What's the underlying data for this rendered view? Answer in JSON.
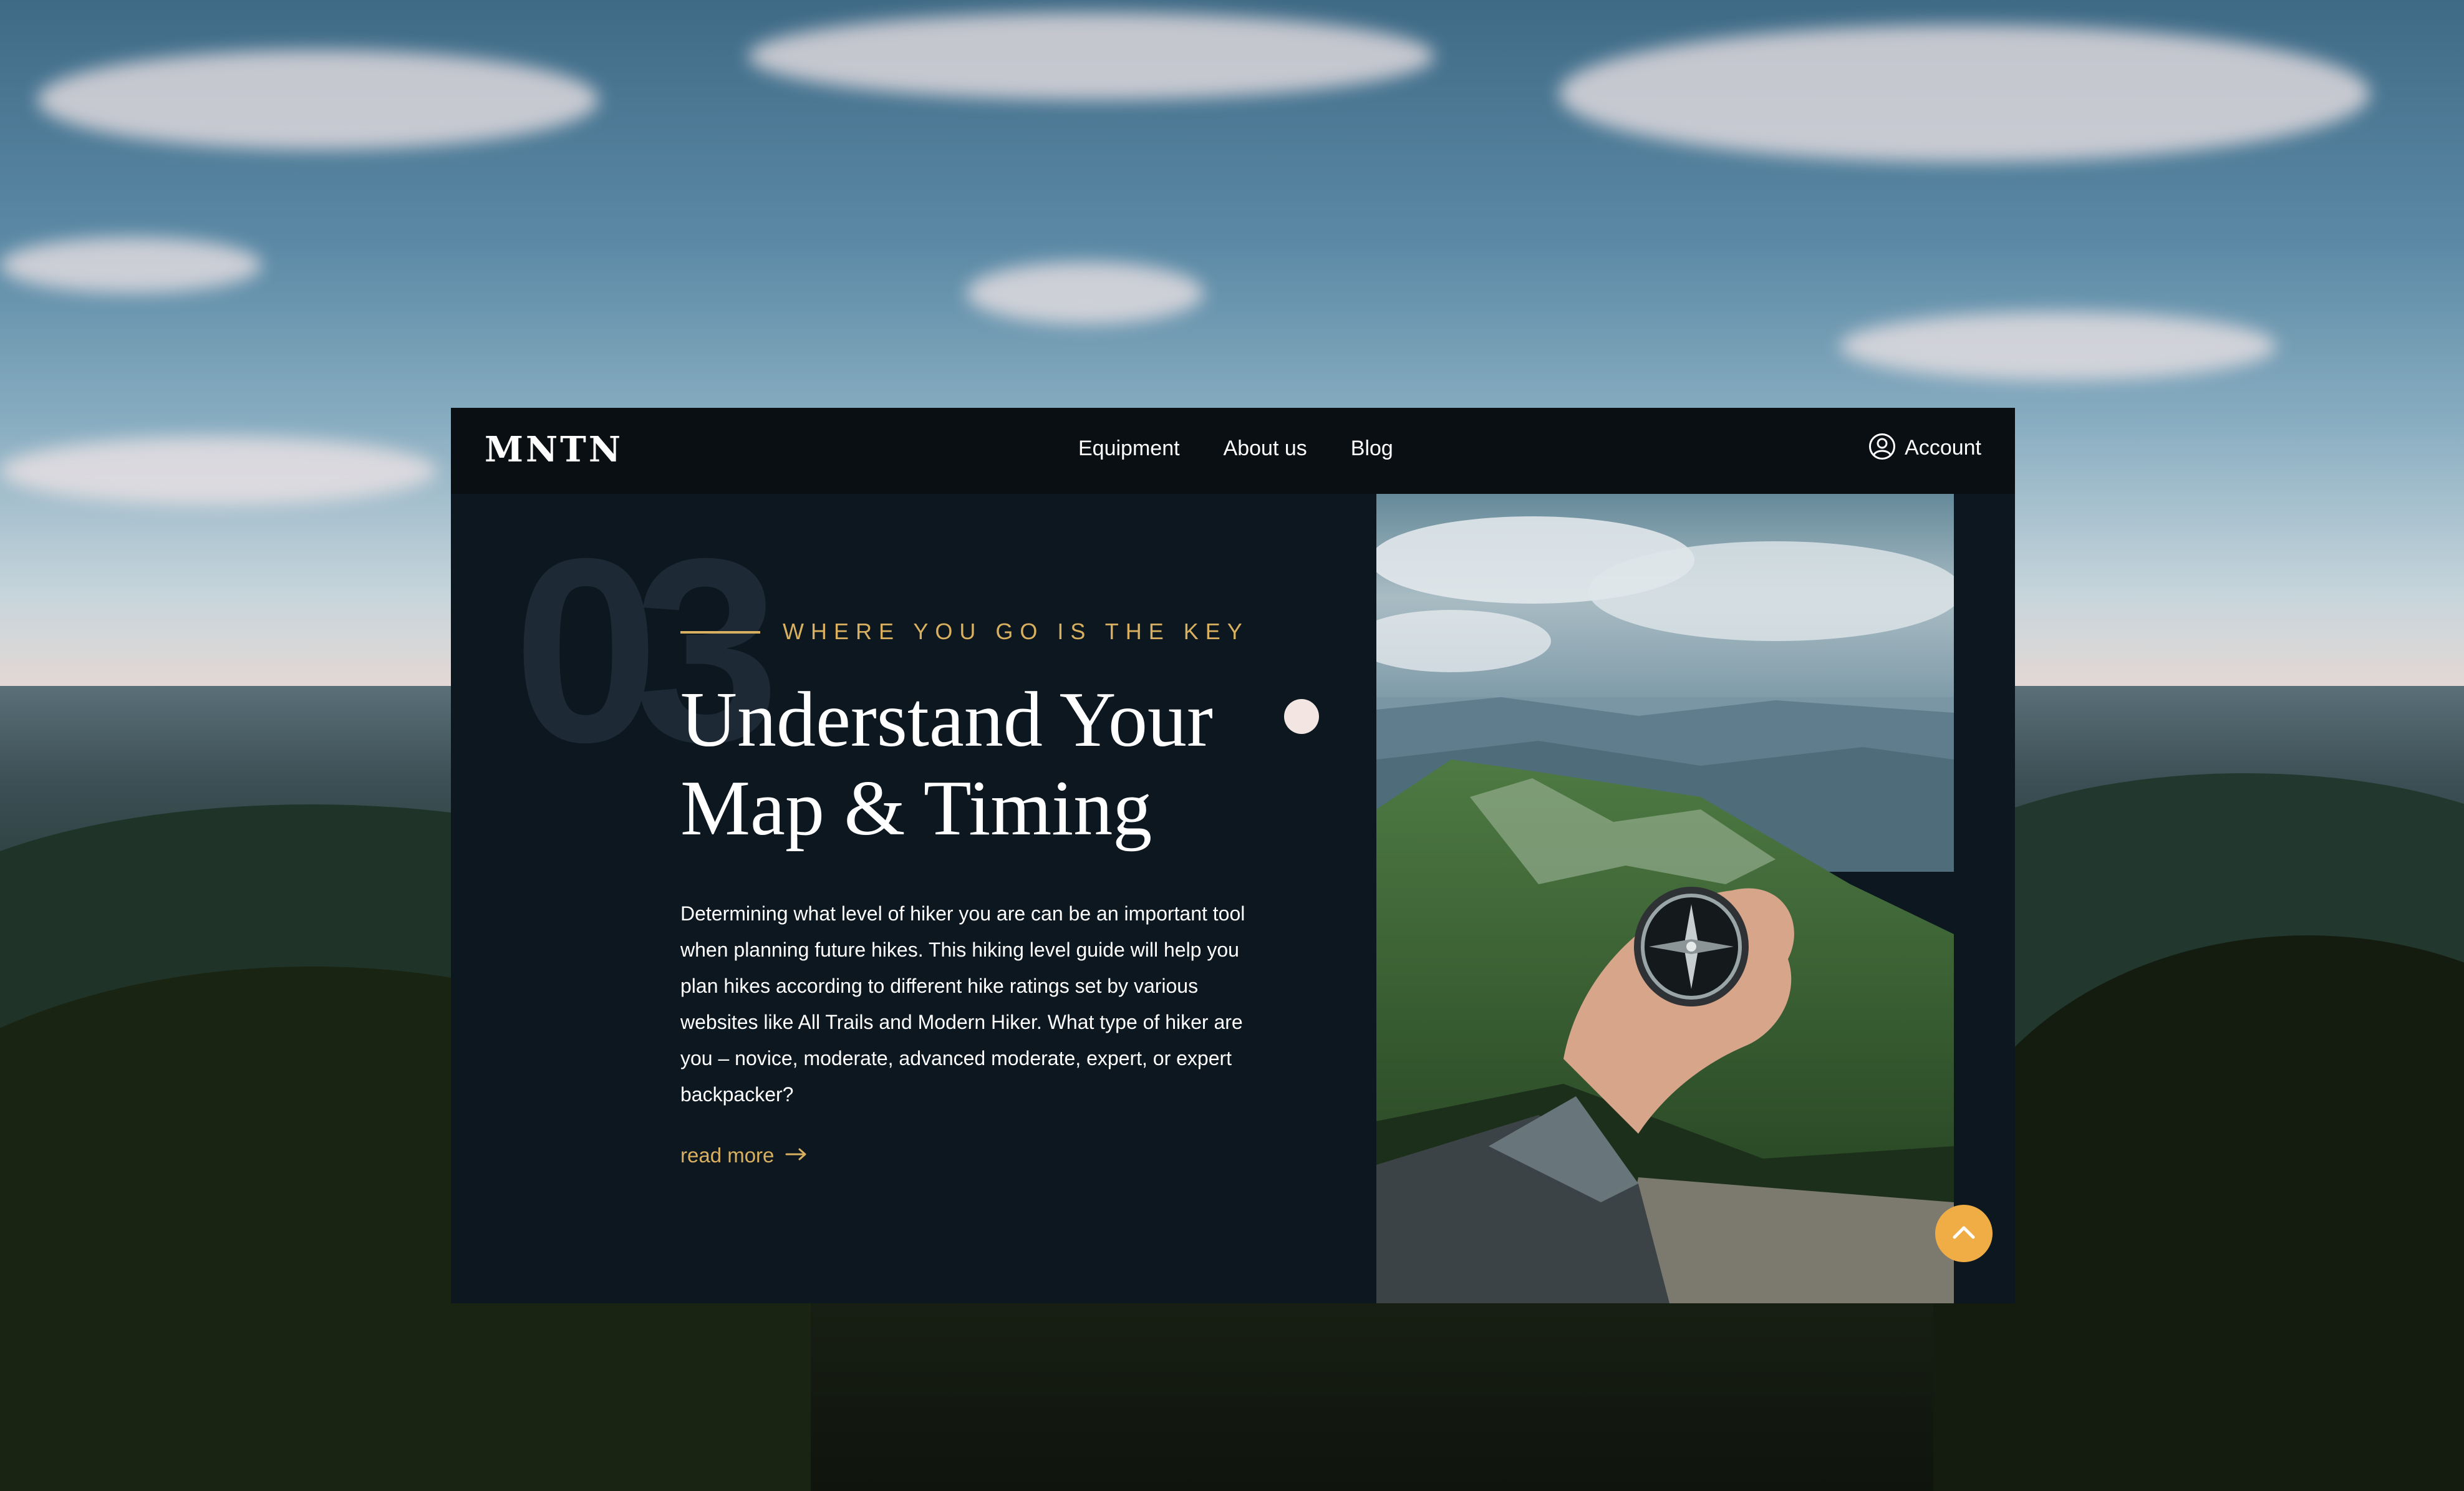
{
  "brand": {
    "logo": "MNTN"
  },
  "nav": {
    "items": [
      {
        "label": "Equipment"
      },
      {
        "label": "About us"
      },
      {
        "label": "Blog"
      }
    ],
    "account_label": "Account"
  },
  "section": {
    "number": "03",
    "eyebrow": "WHERE YOU GO IS THE KEY",
    "title": "Understand Your Map & Timing",
    "body": "Determining what level of hiker you are can be an important tool when planning future hikes. This hiking level guide will help you plan hikes according to different hike ratings set by various websites like All Trails and Modern Hiker. What type of hiker are you – novice, moderate, advanced moderate, expert, or expert backpacker?",
    "read_more_label": "read more"
  },
  "icons": {
    "account": "user-circle-icon",
    "read_more": "arrow-right-icon",
    "scroll_top": "chevron-up-icon",
    "photo_subject": "hand-holding-compass"
  },
  "colors": {
    "accent": "#d9b05f",
    "panel_bg": "#0c1720",
    "nav_bg": "#0a0f14",
    "scroll_button": "#f0ad45"
  }
}
